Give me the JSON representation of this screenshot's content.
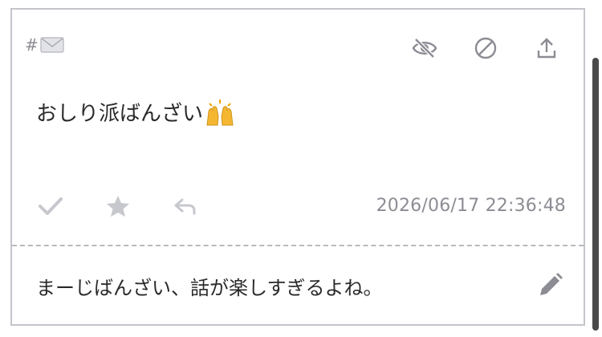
{
  "post": {
    "tag_hash": "#",
    "tag_icon": "envelope-icon",
    "text": "おしり派ばんざい",
    "text_emoji_icon": "raising-hands-icon",
    "timestamp": "2026/06/17 22:36:48"
  },
  "top_actions": [
    {
      "icon": "eye-slash-icon"
    },
    {
      "icon": "block-icon"
    },
    {
      "icon": "share-upload-icon"
    }
  ],
  "bottom_actions": [
    {
      "icon": "checkmark-icon"
    },
    {
      "icon": "star-icon"
    },
    {
      "icon": "reply-icon"
    }
  ],
  "reply": {
    "text": "まーじばんざい、話が楽しすぎるよね。",
    "edit_icon": "pencil-icon"
  },
  "colors": {
    "icon": "#8c8c94",
    "icon_light": "#c7c8ce",
    "text": "#2a2a2a",
    "border": "#c4c5cb",
    "scrollbar": "#4a4a4a",
    "emoji": "#f5b731"
  }
}
